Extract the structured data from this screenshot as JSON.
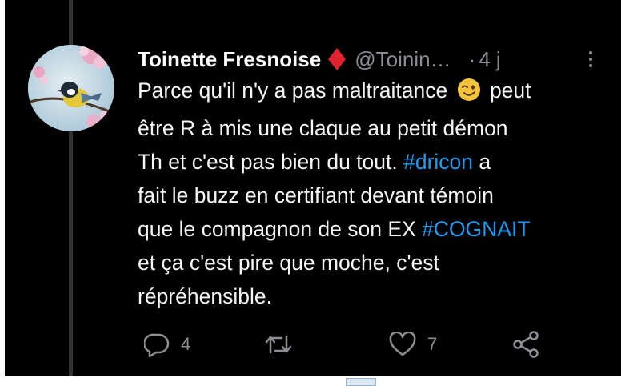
{
  "tweet": {
    "author_name": "Toinette Fresnoise",
    "handle": "@Toinin…",
    "separator": "·",
    "time": "4 j",
    "text_lines": [
      [
        {
          "t": "Parce qu'il n'y a pas maltraitance "
        },
        {
          "emoji": "winking-face"
        },
        {
          "t": " peut"
        }
      ],
      [
        {
          "t": "être R à mis une claque au petit démon"
        }
      ],
      [
        {
          "t": "Th et c'est pas bien du tout. "
        },
        {
          "tag": "#dricon"
        },
        {
          "t": " a"
        }
      ],
      [
        {
          "t": "fait le buzz en certifiant devant témoin"
        }
      ],
      [
        {
          "t": "que le compagnon de son EX "
        },
        {
          "tag": "#COGNAIT"
        }
      ],
      [
        {
          "t": "et ça c'est pire que moche, c'est"
        }
      ],
      [
        {
          "t": "répréhensible."
        }
      ]
    ],
    "actions": {
      "reply_count": "4",
      "retweet_count": "",
      "like_count": "7"
    },
    "icons": {
      "badge": "red-diamond-icon",
      "reply": "reply-bubble-icon",
      "retweet": "retweet-icon",
      "like": "heart-icon",
      "share": "share-icon",
      "more": "more-vertical-icon"
    },
    "colors": {
      "background": "#000000",
      "text": "#e7e9ea",
      "hashtag": "#1d9bf0",
      "secondary": "#8b8f94",
      "badge": "#e0242f"
    }
  }
}
